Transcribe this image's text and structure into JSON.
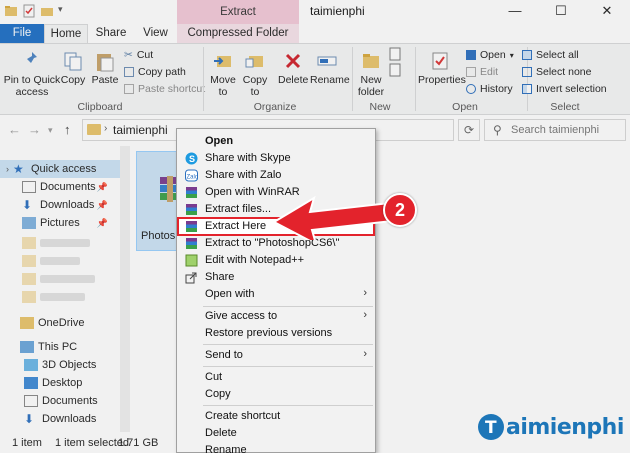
{
  "window": {
    "title": "taimienphi",
    "context_tab_title": "Extract",
    "min": "—",
    "max": "☐",
    "close": "✕"
  },
  "tabs": {
    "file": "File",
    "home": "Home",
    "share": "Share",
    "view": "View",
    "compressed": "Compressed Folder Tools"
  },
  "ribbon": {
    "pin": "Pin to Quick access",
    "copy": "Copy",
    "paste": "Paste",
    "cut": "Cut",
    "copy_path": "Copy path",
    "paste_shortcut": "Paste shortcut",
    "clipboard_group": "Clipboard",
    "move_to": "Move to",
    "copy_to": "Copy to",
    "delete": "Delete",
    "rename": "Rename",
    "organize_group": "Organize",
    "new_folder": "New folder",
    "new_group": "New",
    "properties": "Properties",
    "open": "Open",
    "edit": "Edit",
    "history": "History",
    "open_group": "Open",
    "select_all": "Select all",
    "select_none": "Select none",
    "invert_selection": "Invert selection",
    "select_group": "Select"
  },
  "address": {
    "crumb": "taimienphi",
    "search_placeholder": "Search taimienphi"
  },
  "navpane": {
    "quick_access": "Quick access",
    "documents": "Documents",
    "downloads": "Downloads",
    "pictures": "Pictures",
    "onedrive": "OneDrive",
    "this_pc": "This PC",
    "objects3d": "3D Objects",
    "desktop": "Desktop",
    "documents2": "Documents",
    "downloads2": "Downloads"
  },
  "file": {
    "name": "Photosh"
  },
  "context_menu": {
    "items": [
      {
        "label": "Open"
      },
      {
        "label": "Share with Skype"
      },
      {
        "label": "Share with Zalo"
      },
      {
        "label": "Open with WinRAR"
      },
      {
        "label": "Extract files..."
      },
      {
        "label": "Extract Here"
      },
      {
        "label": "Extract to \"PhotoshopCS6\\\""
      },
      {
        "label": "Edit with Notepad++"
      },
      {
        "label": "Share"
      },
      {
        "label": "Open with"
      },
      {
        "label": "Give access to"
      },
      {
        "label": "Restore previous versions"
      },
      {
        "label": "Send to"
      },
      {
        "label": "Cut"
      },
      {
        "label": "Copy"
      },
      {
        "label": "Create shortcut"
      },
      {
        "label": "Delete"
      },
      {
        "label": "Rename"
      }
    ],
    "submenu_arrow": "›"
  },
  "annotation": {
    "step": "2"
  },
  "status": {
    "count": "1 item",
    "selected": "1 item selected",
    "size": "1.71 GB"
  },
  "watermark": {
    "text": "aimienphi",
    "letter": "T"
  },
  "colors": {
    "accent": "#1c6fc7",
    "highlight_red": "#e3232c",
    "context_tab": "#f3c9d8"
  }
}
